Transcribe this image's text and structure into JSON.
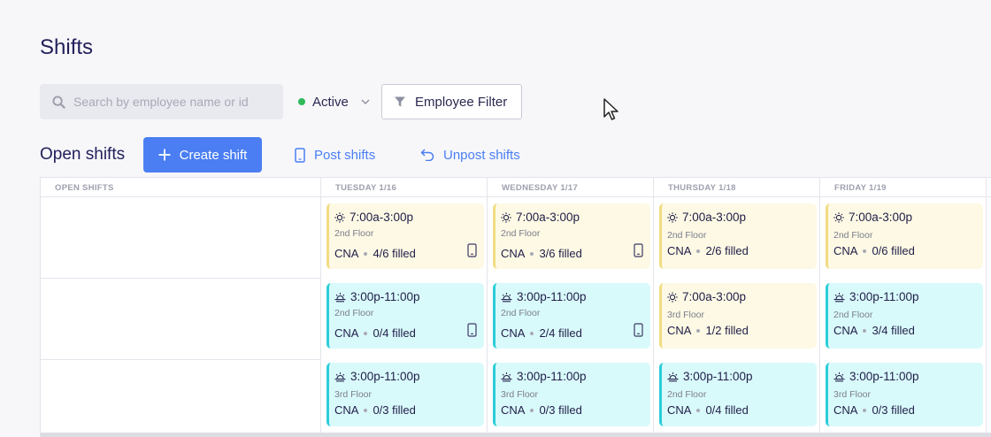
{
  "page": {
    "title": "Shifts"
  },
  "search": {
    "placeholder": "Search by employee name or id",
    "icon": "search-icon"
  },
  "status_filter": {
    "label": "Active",
    "dot_color": "#2fb95a"
  },
  "employee_filter": {
    "label": "Employee Filter",
    "icon": "funnel-icon"
  },
  "open_shifts": {
    "title": "Open shifts",
    "create_label": "Create shift",
    "post_label": "Post shifts",
    "unpost_label": "Unpost shifts"
  },
  "columns": [
    "OPEN SHIFTS",
    "TUESDAY 1/16",
    "WEDNESDAY 1/17",
    "THURSDAY 1/18",
    "FRIDAY 1/19"
  ],
  "rows": [
    [
      {
        "type": "day",
        "time": "7:00a-3:00p",
        "location": "2nd Floor",
        "role": "CNA",
        "filled": "4/6 filled",
        "posted": true
      },
      {
        "type": "day",
        "time": "7:00a-3:00p",
        "location": "2nd Floor",
        "role": "CNA",
        "filled": "3/6 filled",
        "posted": true
      },
      {
        "type": "day",
        "time": "7:00a-3:00p",
        "location": "2nd Floor",
        "role": "CNA",
        "filled": "2/6 filled",
        "posted": false
      },
      {
        "type": "day",
        "time": "7:00a-3:00p",
        "location": "2nd Floor",
        "role": "CNA",
        "filled": "0/6 filled",
        "posted": false
      }
    ],
    [
      {
        "type": "eve",
        "time": "3:00p-11:00p",
        "location": "2nd Floor",
        "role": "CNA",
        "filled": "0/4 filled",
        "posted": true
      },
      {
        "type": "eve",
        "time": "3:00p-11:00p",
        "location": "2nd Floor",
        "role": "CNA",
        "filled": "2/4 filled",
        "posted": true
      },
      {
        "type": "day",
        "time": "7:00a-3:00p",
        "location": "3rd Floor",
        "role": "CNA",
        "filled": "1/2 filled",
        "posted": false
      },
      {
        "type": "eve",
        "time": "3:00p-11:00p",
        "location": "2nd Floor",
        "role": "CNA",
        "filled": "3/4 filled",
        "posted": false
      }
    ],
    [
      {
        "type": "eve",
        "time": "3:00p-11:00p",
        "location": "3rd Floor",
        "role": "CNA",
        "filled": "0/3 filled",
        "posted": false
      },
      {
        "type": "eve",
        "time": "3:00p-11:00p",
        "location": "3rd Floor",
        "role": "CNA",
        "filled": "0/3 filled",
        "posted": false
      },
      {
        "type": "eve",
        "time": "3:00p-11:00p",
        "location": "2nd Floor",
        "role": "CNA",
        "filled": "0/4 filled",
        "posted": false
      },
      {
        "type": "eve",
        "time": "3:00p-11:00p",
        "location": "3rd Floor",
        "role": "CNA",
        "filled": "0/3 filled",
        "posted": false
      }
    ]
  ],
  "colors": {
    "accent": "#4a7ef2",
    "day_bg": "#fdf9e4",
    "day_border": "#f1dc83",
    "eve_bg": "#d9fafb",
    "eve_border": "#2bcdd8"
  }
}
